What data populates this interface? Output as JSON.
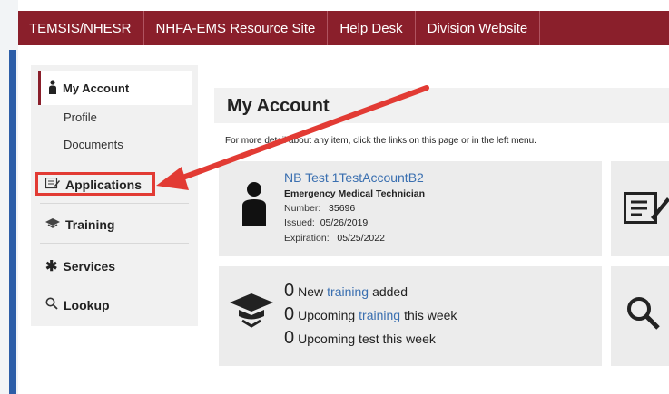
{
  "nav": {
    "items": [
      "TEMSIS/NHESR",
      "NHFA-EMS Resource Site",
      "Help Desk",
      "Division Website"
    ]
  },
  "sidebar": {
    "active": "My Account",
    "sub_items": [
      "Profile",
      "Documents"
    ],
    "items": [
      {
        "label": "Applications",
        "icon": "form-icon"
      },
      {
        "label": "Training",
        "icon": "graduation-cap-icon"
      },
      {
        "label": "Services",
        "icon": "asterisk-icon"
      },
      {
        "label": "Lookup",
        "icon": "search-icon"
      }
    ]
  },
  "main": {
    "title": "My Account",
    "intro": "For more detail about any item, click the links on this page or in the left menu."
  },
  "account": {
    "name": "NB Test 1TestAccountB2",
    "role": "Emergency Medical Technician",
    "number_label": "Number:",
    "number": "35696",
    "issued_label": "Issued:",
    "issued": "05/26/2019",
    "expiration_label": "Expiration:",
    "expiration": "05/25/2022"
  },
  "training": {
    "rows": [
      {
        "count": "0",
        "pre": "New",
        "link": "training",
        "post": "added"
      },
      {
        "count": "0",
        "pre": "Upcoming",
        "link": "training",
        "post": "this week"
      },
      {
        "count": "0",
        "pre": "Upcoming test this week",
        "link": "",
        "post": ""
      }
    ]
  },
  "colors": {
    "nav_bg": "#8a1f2b",
    "link": "#3a6fb0",
    "annotation_red": "#e23b34"
  }
}
